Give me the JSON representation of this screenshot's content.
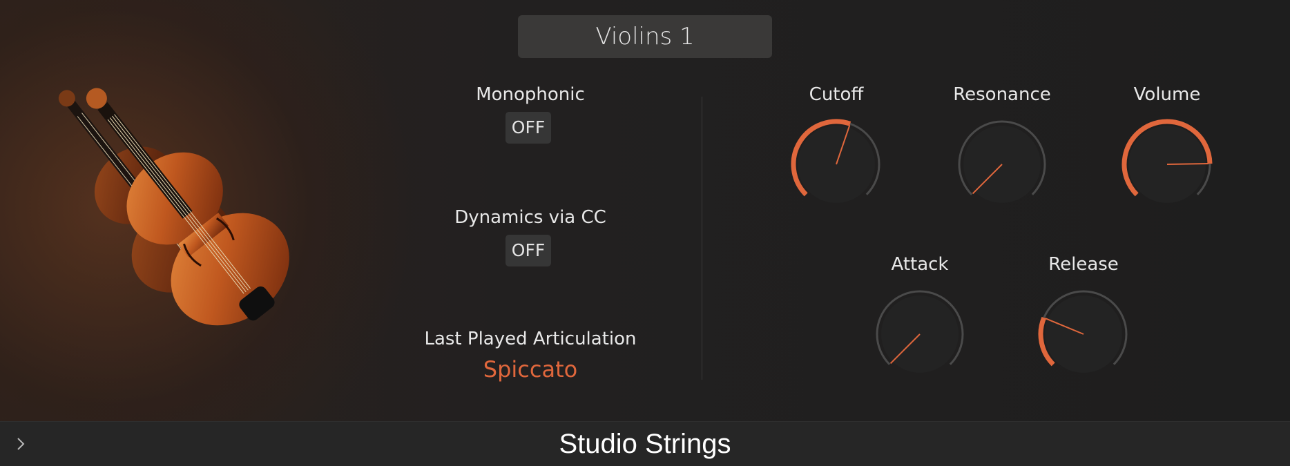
{
  "header": {
    "preset_name": "Violins 1"
  },
  "instrument_image": {
    "icon": "violins-image"
  },
  "controls": {
    "monophonic": {
      "label": "Monophonic",
      "value": "OFF"
    },
    "dynamics": {
      "label": "Dynamics via CC",
      "value": "OFF"
    },
    "articulation": {
      "label": "Last Played Articulation",
      "value": "Spiccato"
    }
  },
  "knobs": [
    {
      "name": "cutoff",
      "label": "Cutoff",
      "value": 0.57
    },
    {
      "name": "resonance",
      "label": "Resonance",
      "value": 0.0
    },
    {
      "name": "volume",
      "label": "Volume",
      "value": 0.83
    },
    {
      "name": "attack",
      "label": "Attack",
      "value": 0.0
    },
    {
      "name": "release",
      "label": "Release",
      "value": 0.25
    }
  ],
  "footer": {
    "title": "Studio Strings",
    "expand_icon": "chevron-right-icon"
  },
  "colors": {
    "accent": "#e0673c",
    "knob_track": "#4a4a4a",
    "knob_body": "#232323"
  }
}
